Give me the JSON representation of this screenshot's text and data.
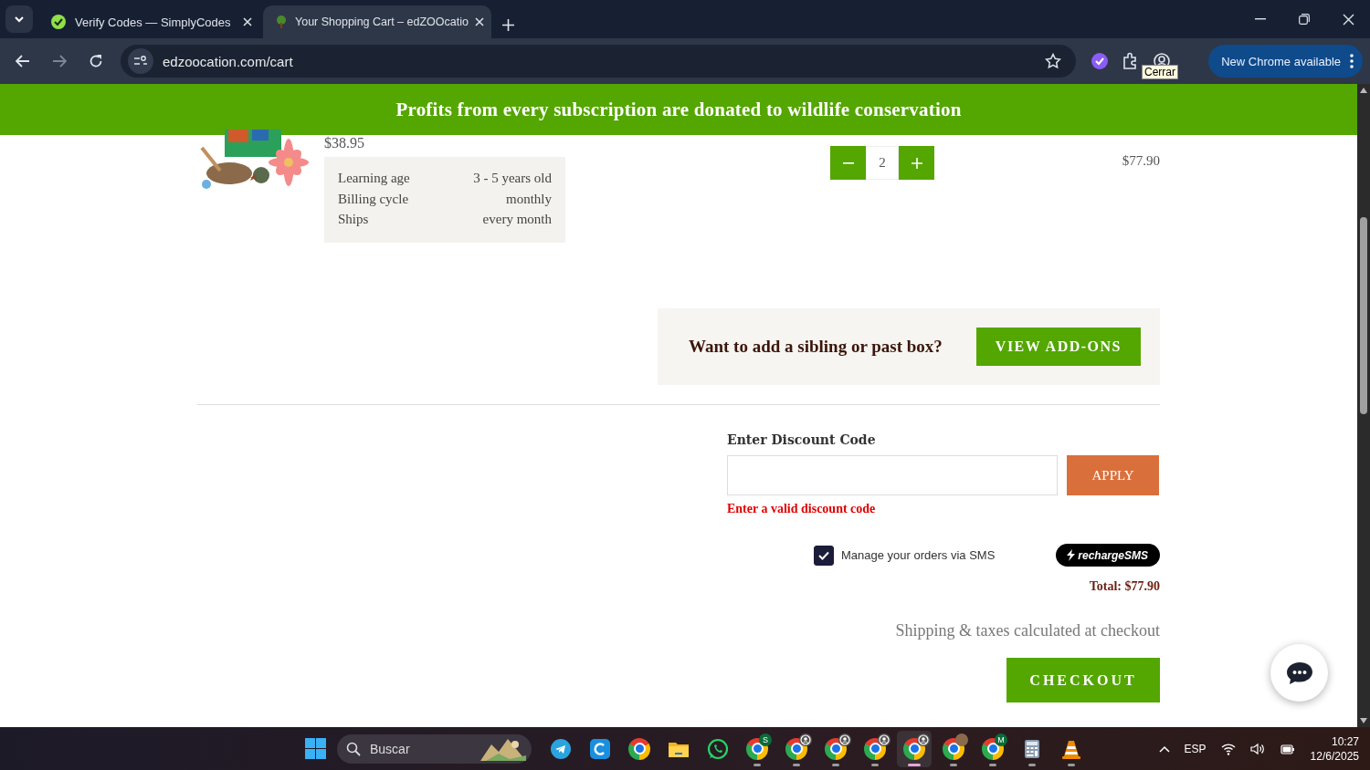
{
  "browser": {
    "tabs": [
      {
        "title": "Verify Codes — SimplyCodes",
        "selected": false
      },
      {
        "title": "Your Shopping Cart – edZOOcatio",
        "selected": true
      }
    ],
    "url": "edzoocation.com/cart",
    "tooltip": "Cerrar",
    "update_button": "New Chrome available"
  },
  "banner": "Profits from every subscription are donated to wildlife conservation",
  "cart_item": {
    "price": "$38.95",
    "details": [
      {
        "label": "Learning age",
        "value": "3 - 5 years old"
      },
      {
        "label": "Billing cycle",
        "value": "monthly"
      },
      {
        "label": "Ships",
        "value": "every month"
      }
    ],
    "quantity": "2",
    "line_total": "$77.90"
  },
  "addons": {
    "prompt": "Want to add a sibling or past box?",
    "button": "VIEW ADD-ONS"
  },
  "discount": {
    "label": "Enter Discount Code",
    "button": "APPLY",
    "error": "Enter a valid discount code"
  },
  "sms": {
    "label": "Manage your orders via SMS",
    "checked": true,
    "badge": "rechargeSMS"
  },
  "total": "Total: $77.90",
  "shipping_note": "Shipping & taxes calculated at checkout",
  "checkout": "CHECKOUT",
  "taskbar": {
    "search": "Buscar",
    "apps": [
      {
        "kind": "telegram",
        "running": false,
        "selected": false
      },
      {
        "kind": "letter-app",
        "running": false,
        "selected": false
      },
      {
        "kind": "chrome",
        "running": false,
        "selected": false
      },
      {
        "kind": "folder",
        "running": false,
        "selected": false
      },
      {
        "kind": "whatsapp",
        "running": false,
        "selected": false
      },
      {
        "kind": "chrome",
        "badge": "S",
        "running": true,
        "selected": false
      },
      {
        "kind": "chrome-profile",
        "running": true,
        "selected": false
      },
      {
        "kind": "chrome-profile",
        "running": true,
        "selected": false
      },
      {
        "kind": "chrome-profile",
        "running": true,
        "selected": false
      },
      {
        "kind": "chrome-profile",
        "running": true,
        "selected": true
      },
      {
        "kind": "chrome-avatar",
        "running": true,
        "selected": false
      },
      {
        "kind": "chrome",
        "badge": "M",
        "running": true,
        "selected": false
      },
      {
        "kind": "calculator",
        "running": true,
        "selected": false
      },
      {
        "kind": "vlc",
        "running": true,
        "selected": false
      }
    ]
  },
  "tray": {
    "language": "ESP",
    "time": "10:27",
    "date": "12/6/2025"
  }
}
